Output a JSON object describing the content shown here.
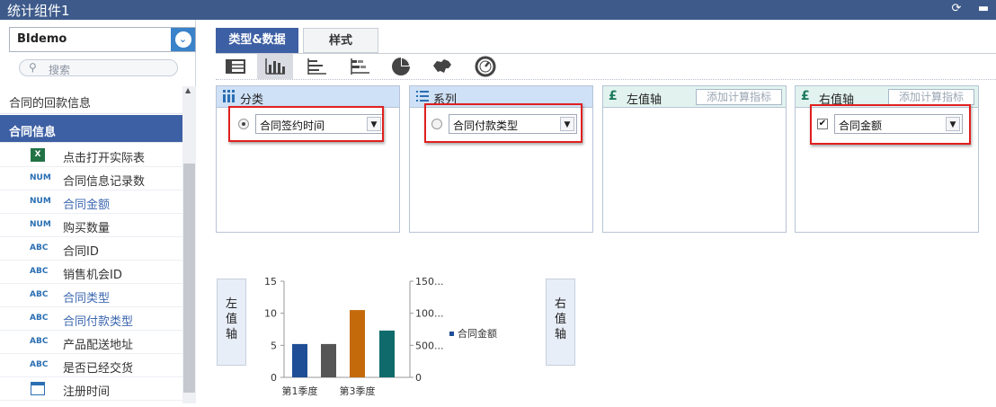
{
  "window": {
    "title": "统计组件1"
  },
  "datasource": {
    "value": "BIdemo"
  },
  "search": {
    "placeholder": "搜索"
  },
  "tree": {
    "groups": [
      {
        "label": "合同的回款信息"
      },
      {
        "label": "合同信息"
      }
    ],
    "fields": [
      {
        "tag": "",
        "label": "点击打开实际表",
        "icon": "excel-icon"
      },
      {
        "tag": "NUM",
        "label": "合同信息记录数"
      },
      {
        "tag": "NUM",
        "label": "合同金额"
      },
      {
        "tag": "NUM",
        "label": "购买数量"
      },
      {
        "tag": "ABC",
        "label": "合同ID"
      },
      {
        "tag": "ABC",
        "label": "销售机会ID"
      },
      {
        "tag": "ABC",
        "label": "合同类型"
      },
      {
        "tag": "ABC",
        "label": "合同付款类型"
      },
      {
        "tag": "ABC",
        "label": "产品配送地址"
      },
      {
        "tag": "ABC",
        "label": "是否已经交货"
      },
      {
        "tag": "",
        "label": "注册时间",
        "icon": "calendar-icon"
      }
    ]
  },
  "tabs": [
    {
      "label": "类型&数据"
    },
    {
      "label": "样式"
    }
  ],
  "zones": {
    "category": {
      "title": "分类",
      "field": "合同签约时间"
    },
    "series": {
      "title": "系列",
      "field": "合同付款类型"
    },
    "left_axis": {
      "title": "左值轴",
      "calc": "添加计算指标"
    },
    "right_axis": {
      "title": "右值轴",
      "calc": "添加计算指标",
      "field": "合同金额",
      "checkmark": "✔"
    }
  },
  "axis_buttons": {
    "left": "左\n值\n轴",
    "right": "右\n值\n轴"
  },
  "chart_data": {
    "type": "bar",
    "categories": [
      "第1季度",
      "",
      "第3季度",
      ""
    ],
    "values": [
      5.2,
      5.2,
      10.5,
      7.3
    ],
    "colors": [
      "#1f4e96",
      "#555555",
      "#c46a0b",
      "#0f6b6b"
    ],
    "left_ticks": [
      "15",
      "10",
      "5",
      "0"
    ],
    "right_ticks": [
      "150...",
      "100...",
      "500...",
      "0"
    ],
    "ylim": [
      0,
      15
    ],
    "legend": "合同金额",
    "legend_color": "#1f4e96"
  }
}
